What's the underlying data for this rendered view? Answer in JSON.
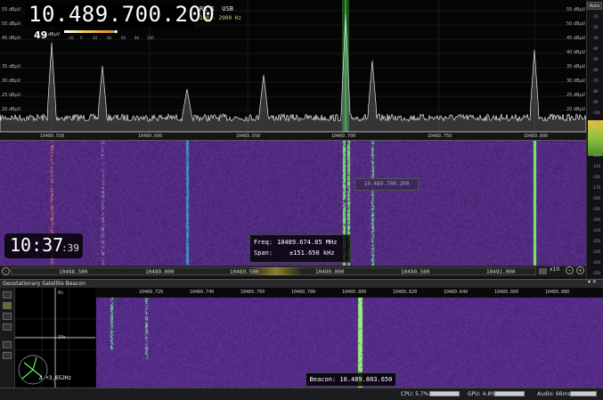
{
  "spectrum": {
    "frequency": "10.489.700.200",
    "rx": "RX 1",
    "mode": "USB",
    "bandwidth": "100 - 2900 Hz",
    "level_value": "49",
    "level_unit": "dBµV",
    "level_scale": [
      "-20",
      "0",
      "20",
      "40",
      "60",
      "80",
      "100"
    ],
    "db_labels": [
      "55 dBµV",
      "50 dBµV",
      "45 dBµV",
      "40 dBµV",
      "35 dBµV",
      "30 dBµV",
      "25 dBµV",
      "20 dBµV"
    ],
    "freq_labels": [
      "10489.550",
      "10489.600",
      "10489.650",
      "10489.700",
      "10489.750",
      "10489.800"
    ]
  },
  "gauge": {
    "auto_label": "Auto",
    "ticks": [
      "-10",
      "-20",
      "-30",
      "-40",
      "-50",
      "-60",
      "-70",
      "-80",
      "-90",
      "-100",
      "-110",
      "-120",
      "-130",
      "-140",
      "-150",
      "-160",
      "-170",
      "-180",
      "-190",
      "-200",
      "-210",
      "-220",
      "-230",
      "-240",
      "-250"
    ]
  },
  "waterfall": {
    "clock_main": "10:37",
    "clock_sec": ":39",
    "cursor_freq": "10.489.700.200",
    "tip_freq_label": "Freq:",
    "tip_freq_value": "10489.674.85 MHz",
    "tip_span_label": "Span:",
    "tip_span_value": "±151.650 kHz"
  },
  "scroll": {
    "labels": [
      "10488.500",
      "10489.000",
      "10489.500",
      "10490.000",
      "10490.500",
      "10491.000"
    ],
    "zoom": "x10"
  },
  "panel": {
    "title": "Geostationary Satellite Beacon",
    "controls": "▾ ✕",
    "scale_labels": [
      "10489.720",
      "10489.740",
      "10489.760",
      "10489.780",
      "10489.800",
      "10489.820",
      "10489.840",
      "10489.860",
      "10489.880"
    ],
    "delta": "Δ +3,652Hz",
    "beacon": "Beacon: 10.489.803.650",
    "scope_labels": [
      "0s",
      "10s"
    ]
  },
  "status": {
    "cpu": "CPU: 5.7%",
    "gpu": "GPU: 4.8%",
    "audio": "Audio: 66ms"
  },
  "colors": {
    "waterfall_bg": "#4a2a7a",
    "signal_green": "#3ddc50",
    "freq_text": "#ffffff"
  }
}
